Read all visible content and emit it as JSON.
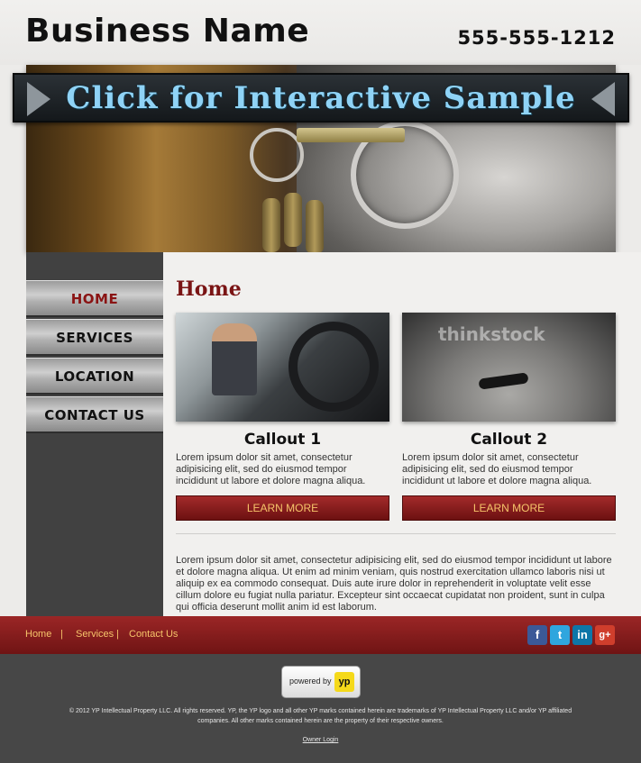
{
  "header": {
    "business_name": "Business Name",
    "phone": "555-555-1212"
  },
  "banner": {
    "text": "Click for Interactive Sample"
  },
  "sidebar": {
    "items": [
      {
        "label": "HOME",
        "active": true
      },
      {
        "label": "SERVICES",
        "active": false
      },
      {
        "label": "LOCATION",
        "active": false
      },
      {
        "label": "CONTACT US",
        "active": false
      }
    ]
  },
  "main": {
    "title": "Home",
    "callouts": [
      {
        "title": "Callout 1",
        "text": "Lorem ipsum dolor sit amet, consectetur adipisicing elit, sed do eiusmod tempor incididunt ut labore et dolore magna aliqua.",
        "button": "LEARN MORE"
      },
      {
        "title": "Callout 2",
        "text": "Lorem ipsum dolor sit amet, consectetur adipisicing elit, sed do eiusmod tempor incididunt ut labore et dolore magna aliqua.",
        "button": "LEARN MORE",
        "watermark": "thinkstock"
      }
    ],
    "body": "Lorem ipsum dolor sit amet, consectetur adipisicing elit, sed do eiusmod tempor incididunt ut labore et dolore magna aliqua. Ut enim ad minim veniam, quis nostrud exercitation ullamco laboris nisi ut aliquip ex ea commodo consequat. Duis aute irure dolor in reprehenderit in voluptate velit esse cillum dolore eu fugiat nulla pariatur. Excepteur sint occaecat cupidatat non proident, sunt in culpa qui officia deserunt mollit anim id est laborum."
  },
  "footer_nav": {
    "links": [
      "Home",
      "Services",
      "Contact Us"
    ],
    "separator": "|",
    "social": [
      {
        "icon": "facebook-icon",
        "glyph": "f"
      },
      {
        "icon": "twitter-icon",
        "glyph": "t"
      },
      {
        "icon": "linkedin-icon",
        "glyph": "in"
      },
      {
        "icon": "google-plus-icon",
        "glyph": "g+"
      }
    ]
  },
  "footer": {
    "powered_by": "powered by",
    "yp_logo": "yp",
    "legal": "© 2012 YP Intellectual Property LLC. All rights reserved. YP, the YP logo and all other YP marks contained herein are trademarks of YP Intellectual Property LLC and/or YP affiliated companies. All other marks contained herein are the property of their respective owners.",
    "owner_login": "Owner Login"
  },
  "colors": {
    "accent": "#7a1414",
    "link": "#f6c46a",
    "banner_text": "#8fd3f6",
    "footer_bg": "#474747"
  }
}
